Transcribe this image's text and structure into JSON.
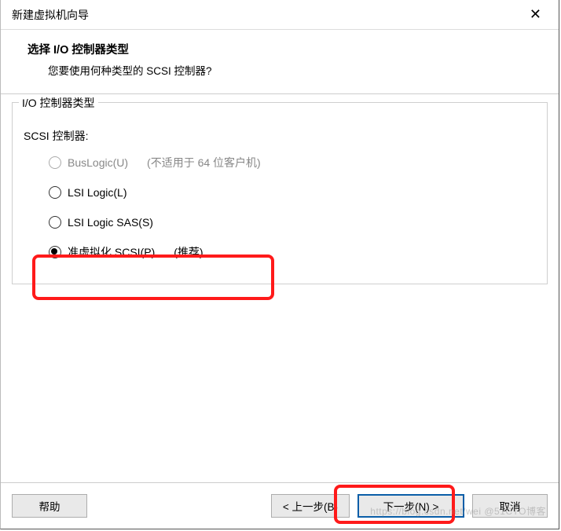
{
  "window": {
    "title": "新建虚拟机向导",
    "close_glyph": "✕"
  },
  "header": {
    "heading": "选择 I/O 控制器类型",
    "subtext": "您要使用何种类型的 SCSI 控制器?"
  },
  "group": {
    "legend": "I/O 控制器类型",
    "sub_label": "SCSI 控制器:",
    "options": [
      {
        "label": "BusLogic(U)",
        "note": "(不适用于 64 位客户机)",
        "selected": false,
        "disabled": true
      },
      {
        "label": "LSI Logic(L)",
        "note": "",
        "selected": false,
        "disabled": false
      },
      {
        "label": "LSI Logic SAS(S)",
        "note": "",
        "selected": false,
        "disabled": false
      },
      {
        "label": "准虚拟化 SCSI(P)",
        "note": "(推荐)",
        "selected": true,
        "disabled": false
      }
    ]
  },
  "buttons": {
    "help": "帮助",
    "back": "< 上一步(B)",
    "next": "下一步(N) >",
    "cancel": "取消"
  },
  "watermark": "https://blog.csdn.net/wei @51CTO博客"
}
